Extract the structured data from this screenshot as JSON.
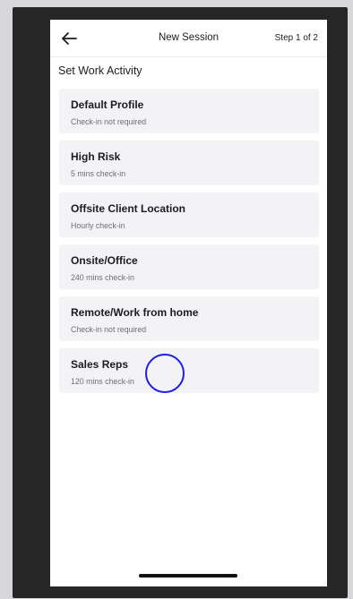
{
  "header": {
    "title": "New Session",
    "step": "Step 1 of 2",
    "back_icon": "arrow-left-icon"
  },
  "section": {
    "title": "Set Work Activity"
  },
  "activities": [
    {
      "name": "Default Profile",
      "checkin": "Check-in not required"
    },
    {
      "name": "High Risk",
      "checkin": "5 mins check-in"
    },
    {
      "name": "Offsite Client Location",
      "checkin": "Hourly check-in"
    },
    {
      "name": "Onsite/Office",
      "checkin": "240 mins check-in"
    },
    {
      "name": "Remote/Work from home",
      "checkin": "Check-in not required"
    },
    {
      "name": "Sales Reps",
      "checkin": "120 mins check-in"
    }
  ],
  "colors": {
    "tap_indicator": "#1d1de6",
    "card_background": "#f3f3f5"
  }
}
